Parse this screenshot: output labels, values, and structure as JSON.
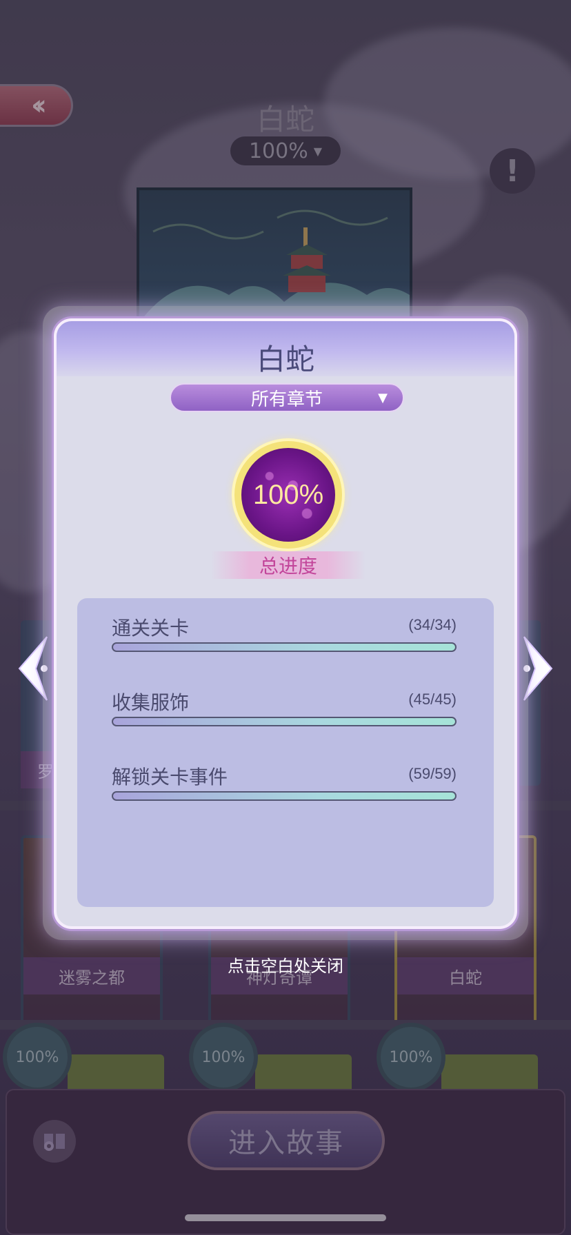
{
  "story": {
    "title": "白蛇",
    "progress_pct": "100%",
    "info_icon": "exclamation-icon",
    "back_icon": "double-chevron-left-icon"
  },
  "shelf": {
    "chapters": [
      {
        "title": "迷雾之都",
        "progress": "100%"
      },
      {
        "title": "神灯奇谭",
        "progress": "100%"
      },
      {
        "title": "白蛇",
        "progress": "100%",
        "selected": true
      }
    ],
    "partial_card_label": "罗"
  },
  "popup": {
    "title": "白蛇",
    "chapter_select": "所有章节",
    "total_progress_value": "100%",
    "total_progress_label": "总进度",
    "stats": [
      {
        "name": "通关关卡",
        "count": "(34/34)",
        "fraction": 1.0
      },
      {
        "name": "收集服饰",
        "count": "(45/45)",
        "fraction": 1.0
      },
      {
        "name": "解锁关卡事件",
        "count": "(59/59)",
        "fraction": 1.0
      }
    ],
    "close_hint": "点击空白处关闭"
  },
  "bottom": {
    "enter_button": "进入故事",
    "settings_icon": "book-gear-icon"
  },
  "colors": {
    "popup_bg": "#dcdcea",
    "popup_glow": "#c9a8ff",
    "progress_ring": "#f4e27a",
    "progress_core": "#6a1587",
    "total_label": "#c2459a",
    "stats_panel": "#bcbde3"
  }
}
